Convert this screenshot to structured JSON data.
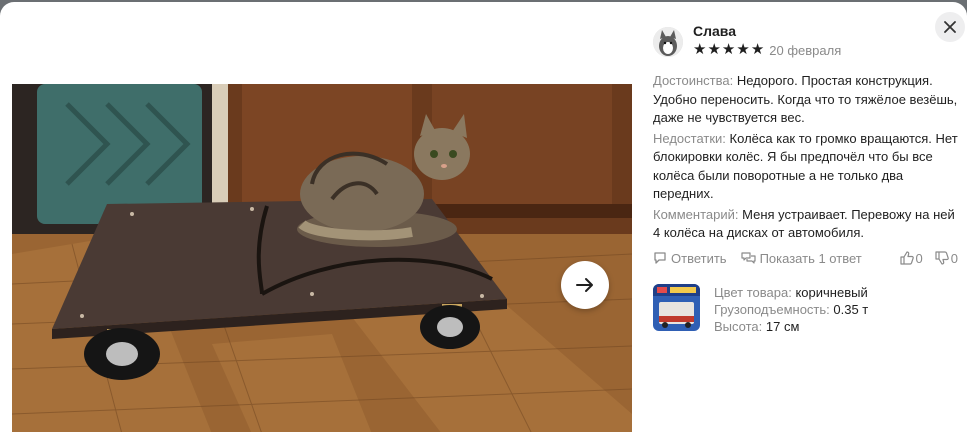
{
  "review": {
    "author": "Слава",
    "rating": 5,
    "date": "20 февраля",
    "pros_label": "Достоинства:",
    "pros_text": "Недорого. Простая конструкция. Удобно переносить. Когда что то тяжёлое везёшь, даже не чувствуется вес.",
    "cons_label": "Недостатки:",
    "cons_text": "Колёса как то громко вращаются. Нет блокировки колёс. Я бы предпочёл что бы все колёса были поворотные а не только два передних.",
    "comment_label": "Комментарий:",
    "comment_text": "Меня устраивает. Перевожу на ней 4 колёса на дисках от автомобиля."
  },
  "actions": {
    "reply": "Ответить",
    "show_replies": "Показать 1 ответ",
    "likes": "0",
    "dislikes": "0"
  },
  "product": {
    "attributes": [
      {
        "key": "Цвет товара:",
        "value": "коричневый"
      },
      {
        "key": "Грузоподъемность:",
        "value": "0.35 т"
      },
      {
        "key": "Высота:",
        "value": "17 см"
      }
    ]
  },
  "icons": {
    "close": "close-icon",
    "next": "arrow-right-icon",
    "reply": "comment-icon",
    "show_replies": "comments-icon",
    "like": "thumb-up-icon",
    "dislike": "thumb-down-icon",
    "star": "star-icon"
  },
  "colors": {
    "text": "#1f1f1f",
    "muted": "#8a8a8a",
    "close_bg": "#eeeeef"
  }
}
